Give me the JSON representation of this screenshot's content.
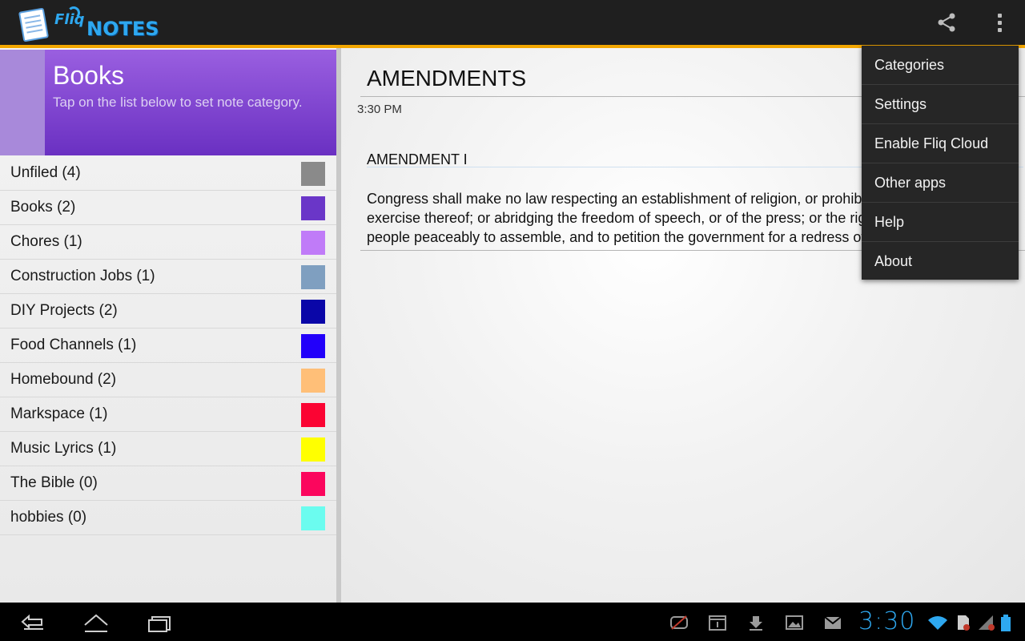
{
  "app": {
    "logo_alt": "Fliq Notes"
  },
  "action_bar": {
    "share_icon": "share-icon",
    "overflow_icon": "overflow-icon"
  },
  "category_header": {
    "title": "Books",
    "subtitle": "Tap on the list below to set note category.",
    "color": "#6f36c6"
  },
  "categories": [
    {
      "label": "Unfiled (4)",
      "color": "#8a8a8a"
    },
    {
      "label": "Books (2)",
      "color": "#6a36c8"
    },
    {
      "label": "Chores (1)",
      "color": "#c07bf8"
    },
    {
      "label": "Construction Jobs (1)",
      "color": "#7f9fc0"
    },
    {
      "label": "DIY Projects (2)",
      "color": "#0a06a8"
    },
    {
      "label": "Food Channels (1)",
      "color": "#2200fa"
    },
    {
      "label": "Homebound (2)",
      "color": "#ffbf78"
    },
    {
      "label": "Markspace (1)",
      "color": "#fb0433"
    },
    {
      "label": "Music Lyrics (1)",
      "color": "#ffff00"
    },
    {
      "label": "The Bible (0)",
      "color": "#fb065d"
    },
    {
      "label": "hobbies (0)",
      "color": "#6bfcef"
    }
  ],
  "note": {
    "title": "AMENDMENTS",
    "time": "3:30 PM",
    "heading": "AMENDMENT I",
    "lines": [
      "Congress shall make no law respecting an establishment of religion, or prohibiting the free",
      "exercise thereof; or abridging the freedom of speech, or of the press; or the right of the",
      "people peaceably to assemble, and to petition the government for a redress of grievances."
    ]
  },
  "menu": {
    "items": [
      "Categories",
      "Settings",
      "Enable Fliq Cloud",
      "Other apps",
      "Help",
      "About"
    ]
  },
  "system_bar": {
    "clock": "3:30",
    "accent": "#2ea8f0"
  }
}
